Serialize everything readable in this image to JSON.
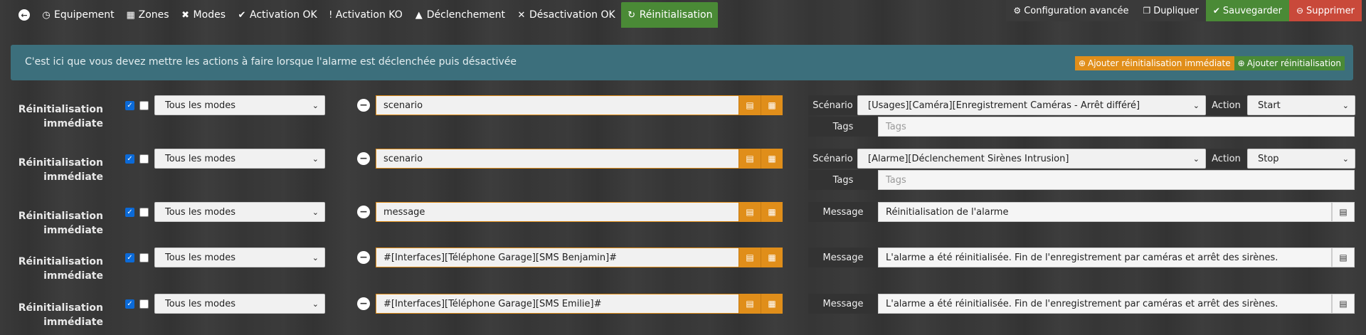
{
  "nav": {
    "back_icon": "arrow-left-circle-icon",
    "tabs": [
      {
        "label": "Equipement",
        "icon": "tachometer-icon"
      },
      {
        "label": "Zones",
        "icon": "grid-icon"
      },
      {
        "label": "Modes",
        "icon": "crossed-tools-icon"
      },
      {
        "label": "Activation OK",
        "icon": "check-icon"
      },
      {
        "label": "Activation KO",
        "icon": "exclamation-icon"
      },
      {
        "label": "Déclenchement",
        "icon": "bell-icon"
      },
      {
        "label": "Désactivation OK",
        "icon": "times-icon"
      },
      {
        "label": "Réinitialisation",
        "icon": "refresh-icon",
        "active": true
      }
    ]
  },
  "toolbar": {
    "config_label": "Configuration avancée",
    "duplicate_label": "Dupliquer",
    "save_label": "Sauvegarder",
    "delete_label": "Supprimer"
  },
  "banner": {
    "text": "C'est ici que vous devez mettre les actions à faire lorsque l'alarme est déclenchée puis désactivée",
    "add_immediate_label": "Ajouter réinitialisation immédiate",
    "add_label": "Ajouter réinitialisation"
  },
  "rows": [
    {
      "label": "Réinitialisation immédiate",
      "mode": "Tous les modes",
      "cmd": "scenario",
      "type": "scenario",
      "scenario_label": "Scénario",
      "scenario": "[Usages][Caméra][Enregistrement Caméras - Arrêt différé]",
      "action_label": "Action",
      "action": "Start",
      "tags_label": "Tags",
      "tags_placeholder": "Tags"
    },
    {
      "label": "Réinitialisation immédiate",
      "mode": "Tous les modes",
      "cmd": "scenario",
      "type": "scenario",
      "scenario_label": "Scénario",
      "scenario": "[Alarme][Déclenchement Sirènes Intrusion]",
      "action_label": "Action",
      "action": "Stop",
      "tags_label": "Tags",
      "tags_placeholder": "Tags"
    },
    {
      "label": "Réinitialisation immédiate",
      "mode": "Tous les modes",
      "cmd": "message",
      "type": "message",
      "message_label": "Message",
      "message": "Réinitialisation de l'alarme"
    },
    {
      "label": "Réinitialisation immédiate",
      "mode": "Tous les modes",
      "cmd": "#[Interfaces][Téléphone Garage][SMS Benjamin]#",
      "type": "message",
      "message_label": "Message",
      "message": "L'alarme a été réinitialisée. Fin de l'enregistrement par caméras et arrêt des sirènes."
    },
    {
      "label": "Réinitialisation immédiate",
      "mode": "Tous les modes",
      "cmd": "#[Interfaces][Téléphone Garage][SMS Emilie]#",
      "type": "message",
      "message_label": "Message",
      "message": "L'alarme a été réinitialisée. Fin de l'enregistrement par caméras et arrêt des sirènes."
    }
  ],
  "colors": {
    "accent_orange": "#e08e1a",
    "accent_green": "#4a8a36",
    "danger_red": "#c9493a",
    "banner_teal": "#3c6f7c"
  }
}
